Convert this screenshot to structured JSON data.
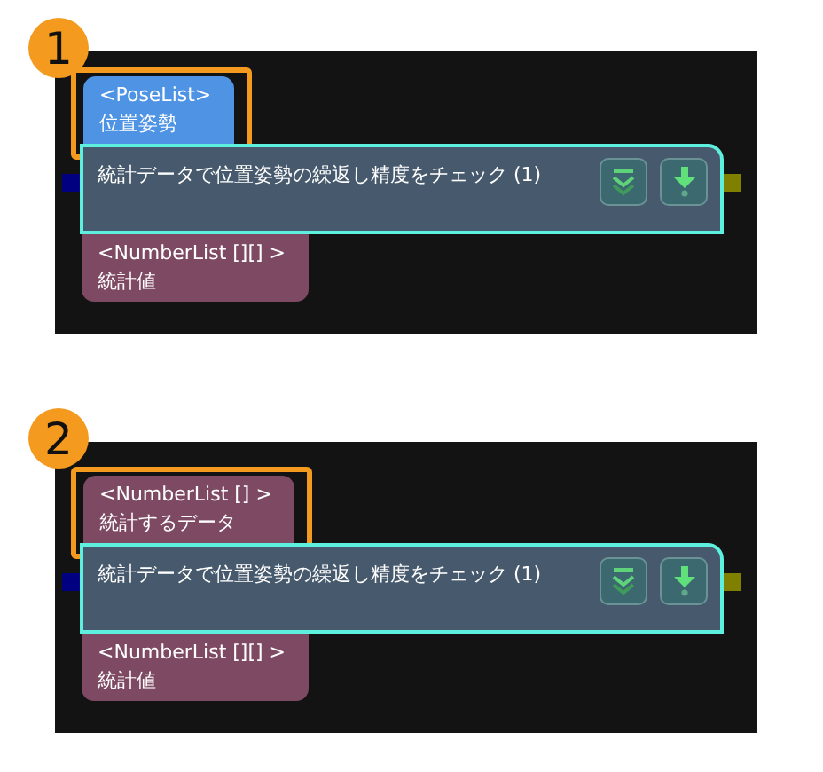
{
  "examples": [
    {
      "badge": "1",
      "input": {
        "type": "<PoseList>",
        "label": "位置姿勢",
        "color": "#4f94e4",
        "highlighted": true
      },
      "node": {
        "title": "統計データで位置姿勢の繰返し精度をチェック (1)"
      },
      "output": {
        "type": "<NumberList [][] >",
        "label": "統計値",
        "color": "#7e4a63"
      }
    },
    {
      "badge": "2",
      "input": {
        "type": "<NumberList [] >",
        "label": "統計するデータ",
        "color": "#7e4a63",
        "highlighted": true
      },
      "node": {
        "title": "統計データで位置姿勢の繰返し精度をチェック (1)"
      },
      "output": {
        "type": "<NumberList [][] >",
        "label": "統計値",
        "color": "#7e4a63"
      }
    }
  ]
}
